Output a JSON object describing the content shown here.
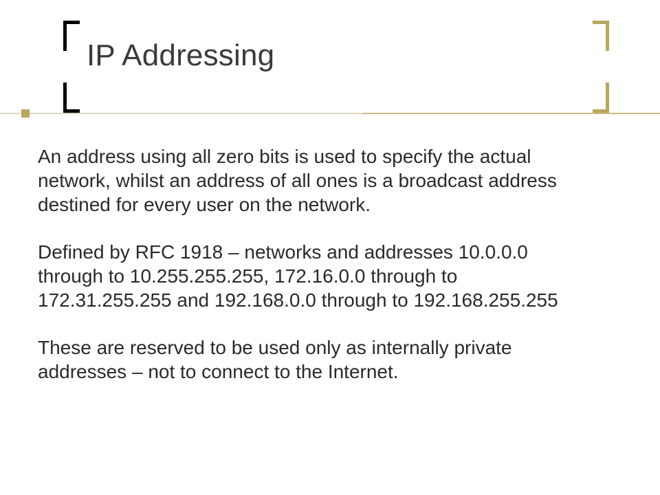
{
  "title": "IP Addressing",
  "paragraphs": [
    "An address using all zero bits is used to specify the actual network, whilst an address of all ones is a broadcast address destined for every user on the network.",
    "Defined by RFC 1918 – networks and addresses 10.0.0.0 through to 10.255.255.255, 172.16.0.0 through to 172.31.255.255 and 192.168.0.0 through to 192.168.255.255",
    "These are reserved to be used only as internally private addresses – not to connect to the Internet."
  ]
}
